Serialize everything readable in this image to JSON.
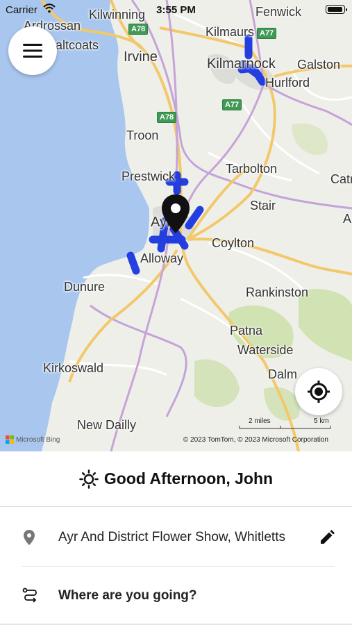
{
  "status_bar": {
    "carrier": "Carrier",
    "time": "3:55 PM"
  },
  "map": {
    "places": [
      "Kilwinning",
      "Fenwick",
      "Ardrossan",
      "Kilmaurs",
      "altcoats",
      "Irvine",
      "Kilmarnock",
      "Galston",
      "Hurlford",
      "Troon",
      "Prestwick",
      "Tarbolton",
      "Catr",
      "Stair",
      "Ayr",
      "A",
      "Coylton",
      "Alloway",
      "Dunure",
      "Rankinston",
      "Patna",
      "Waterside",
      "Dalm",
      "Kirkoswald",
      "New Dailly"
    ],
    "roads": [
      "A78",
      "A77",
      "A78",
      "A77"
    ],
    "scale_miles": "2 miles",
    "scale_km": "5 km",
    "provider": "Microsoft Bing",
    "copyright": "© 2023 TomTom, © 2023 Microsoft Corporation",
    "colors": {
      "sea": "#a9c7ee",
      "land": "#efefea",
      "green": "#c9dea5",
      "route": "#1a36e0",
      "major_road": "#f2c86a",
      "border": "#c3a3d9"
    }
  },
  "controls": {
    "menu_icon": "hamburger-icon",
    "locate_icon": "locate-icon"
  },
  "panel": {
    "greeting_icon": "sun-icon",
    "greeting": "Good Afternoon, John",
    "origin": "Ayr And District Flower Show, Whitletts",
    "destination_placeholder": "Where are you going?"
  }
}
